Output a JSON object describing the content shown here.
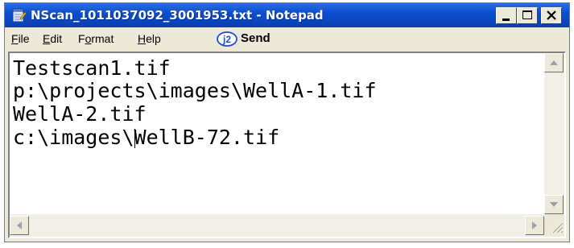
{
  "window": {
    "title": "NScan_1011037092_3001953.txt - Notepad",
    "icons": {
      "app": "notepad-icon",
      "minimize": "minimize-icon",
      "maximize": "maximize-icon",
      "close": "close-icon"
    }
  },
  "menu": {
    "file": {
      "mnemonic": "F",
      "rest": "ile"
    },
    "edit": {
      "mnemonic": "E",
      "rest": "dit"
    },
    "format": {
      "before": "F",
      "mnemonic": "o",
      "after": "rmat"
    },
    "help": {
      "mnemonic": "H",
      "rest": "elp"
    },
    "send": {
      "label": "Send",
      "icon": "j2-send-icon",
      "icon_text": "j2"
    }
  },
  "editor": {
    "lines": [
      "Testscan1.tif",
      "p:\\projects\\images\\WellA-1.tif",
      "WellA-2.tif",
      "c:\\images\\WellB-72.tif"
    ],
    "caret": {
      "line": 4,
      "column": 10
    }
  },
  "scrollbars": {
    "up": "scroll-up-arrow-icon",
    "down": "scroll-down-arrow-icon",
    "left": "scroll-left-arrow-icon",
    "right": "scroll-right-arrow-icon",
    "grip": "resize-grip-icon"
  },
  "colors": {
    "titlebar": "#0a4ed1",
    "menubar": "#ece9d8",
    "editor_bg": "#ffffff"
  }
}
